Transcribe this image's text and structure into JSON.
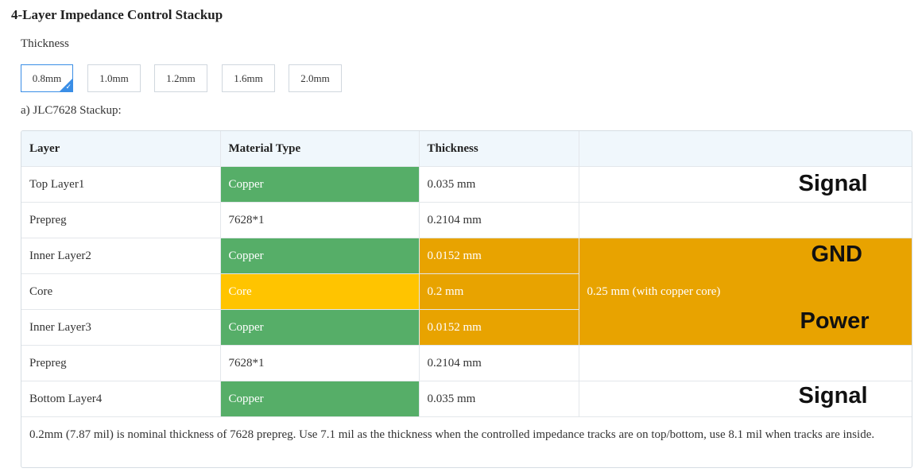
{
  "page": {
    "title": "4-Layer Impedance Control Stackup"
  },
  "thickness": {
    "label": "Thickness",
    "selected": "0.8mm",
    "options": [
      "0.8mm",
      "1.0mm",
      "1.2mm",
      "1.6mm",
      "2.0mm"
    ]
  },
  "stackup": {
    "label": "a) JLC7628 Stackup:",
    "headers": [
      "Layer",
      "Material Type",
      "Thickness",
      ""
    ],
    "rows": [
      {
        "layer": "Top Layer1",
        "material": "Copper",
        "thickness": "0.035 mm",
        "role": "Signal"
      },
      {
        "layer": "Prepreg",
        "material": "7628*1",
        "thickness": "0.2104 mm",
        "role": ""
      },
      {
        "layer": "Inner Layer2",
        "material": "Copper",
        "thickness": "0.0152 mm",
        "role": "GND"
      },
      {
        "layer": "Core",
        "material": "Core",
        "thickness": "0.2 mm",
        "role": ""
      },
      {
        "layer": "Inner Layer3",
        "material": "Copper",
        "thickness": "0.0152 mm",
        "role": "Power"
      },
      {
        "layer": "Prepreg",
        "material": "7628*1",
        "thickness": "0.2104 mm",
        "role": ""
      },
      {
        "layer": "Bottom Layer4",
        "material": "Copper",
        "thickness": "0.035 mm",
        "role": "Signal"
      }
    ],
    "core_note": "0.25 mm (with copper core)",
    "footnote": "0.2mm (7.87 mil) is nominal thickness of 7628 prepreg. Use 7.1 mil as the thickness when the controlled impedance tracks are on top/bottom, use 8.1 mil when tracks are inside."
  },
  "colors": {
    "copper": "#56ae68",
    "core": "#ffc400",
    "core_group": "#e8a300",
    "selected_border": "#3a8ee6",
    "header_bg": "#f0f7fc"
  }
}
